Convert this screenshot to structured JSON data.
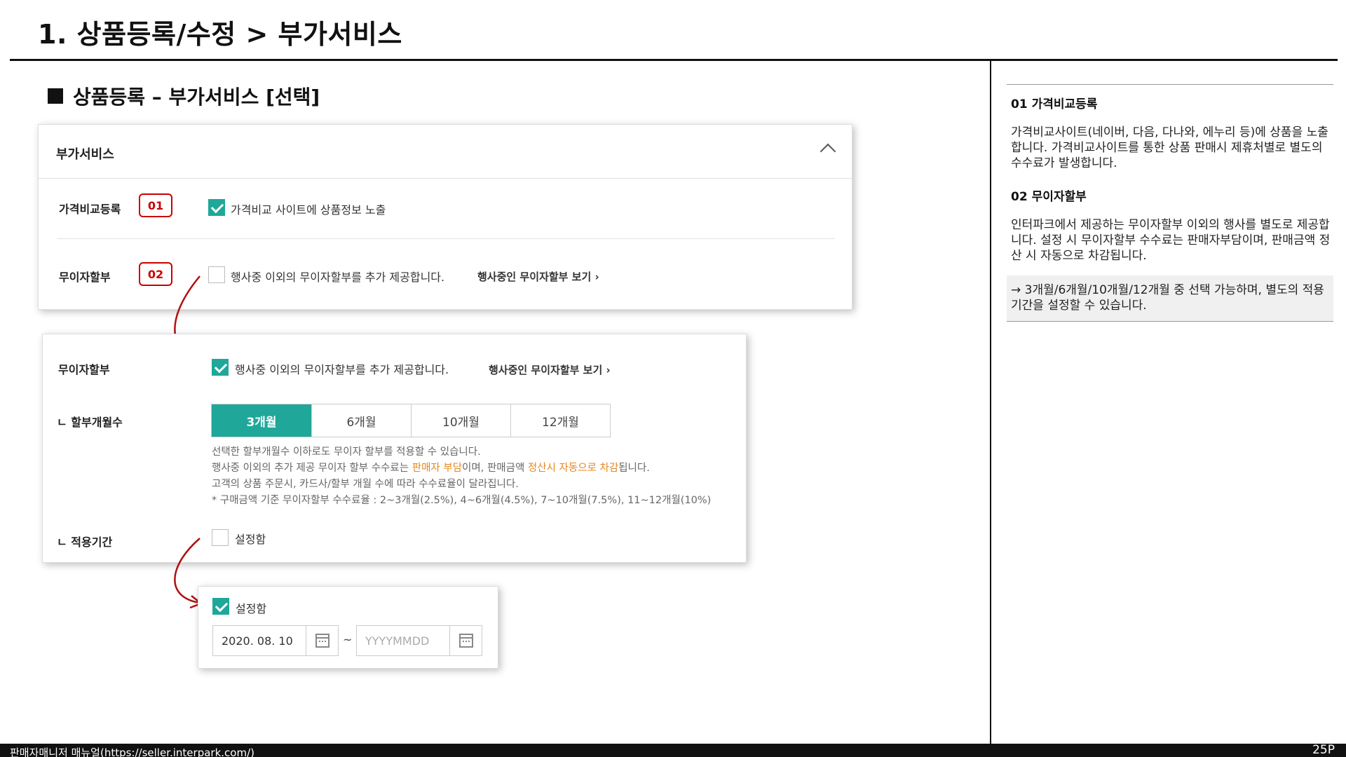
{
  "page": {
    "title": "1. 상품등록/수정 > 부가서비스",
    "section_heading": "상품등록 – 부가서비스 [선택]",
    "footer_left": "판매자매니저 매뉴얼(https://seller.interpark.com/)",
    "footer_right": "25P"
  },
  "card1": {
    "title": "부가서비스",
    "price_compare": {
      "label": "가격비교등록",
      "badge": "01",
      "checkbox_label": "가격비교 사이트에 상품정보 노출",
      "checked": true
    },
    "installment": {
      "label": "무이자할부",
      "badge": "02",
      "checkbox_label": "행사중 이외의 무이자할부를 추가 제공합니다.",
      "checked": false,
      "link": "행사중인 무이자할부 보기 ›"
    }
  },
  "card2": {
    "installment_label": "무이자할부",
    "checkbox_label": "행사중 이외의 무이자할부를 추가 제공합니다.",
    "checked": true,
    "link": "행사중인 무이자할부 보기 ›",
    "months_label": "ㄴ 할부개월수",
    "months_options": [
      "3개월",
      "6개월",
      "10개월",
      "12개월"
    ],
    "months_selected": "3개월",
    "notes": {
      "line1": "선택한 할부개월수 이하로도 무이자 할부를 적용할 수 있습니다.",
      "line2_a": "행사중 이외의 추가 제공 무이자 할부 수수료는 ",
      "line2_b": "판매자 부담",
      "line2_c": "이며, 판매금액 ",
      "line2_d": "정산시 자동으로 차감",
      "line2_e": "됩니다.",
      "line3": "고객의 상품 주문시, 카드사/할부 개월 수에 따라 수수료율이 달라집니다.",
      "line4": "* 구매금액 기준 무이자할부 수수료율 : 2~3개월(2.5%), 4~6개월(4.5%), 7~10개월(7.5%), 11~12개월(10%)"
    },
    "period_label": "ㄴ 적용기간",
    "period_checkbox_label": "설정함",
    "period_checked": false
  },
  "card3": {
    "checkbox_label": "설정함",
    "checked": true,
    "start_date": "2020. 08. 10",
    "tilde": "~",
    "end_placeholder": "YYYYMMDD"
  },
  "side": {
    "h1": "01 가격비교등록",
    "p1": "가격비교사이트(네이버, 다음, 다나와, 에누리 등)에 상품을 노출합니다. 가격비교사이트를 통한 상품 판매시 제휴처별로 별도의 수수료가 발생합니다.",
    "h2": "02 무이자할부",
    "p2": "인터파크에서 제공하는 무이자할부 이외의 행사를 별도로 제공합니다. 설정 시 무이자할부 수수료는 판매자부담이며, 판매금액 정산 시 자동으로 차감됩니다.",
    "note": "→ 3개월/6개월/10개월/12개월 중 선택 가능하며, 별도의 적용기간을 설정할 수 있습니다."
  },
  "colors": {
    "accent": "#1fa79a",
    "badge": "#cc0000",
    "highlight": "#e8861a"
  }
}
